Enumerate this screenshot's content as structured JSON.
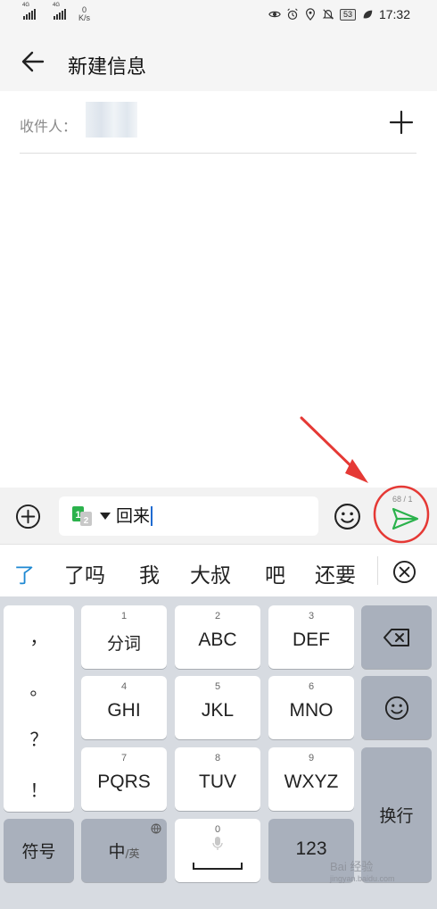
{
  "status_bar": {
    "network_1": "4G",
    "network_2": "4G",
    "speed_value": "0",
    "speed_unit": "K/s",
    "battery": "53",
    "time": "17:32",
    "icons": [
      "eye-icon",
      "alarm-icon",
      "location-icon",
      "mute-icon",
      "battery-icon",
      "leaf-icon"
    ]
  },
  "header": {
    "back_icon": "arrow-left-icon",
    "title": "新建信息"
  },
  "recipient": {
    "label": "收件人：",
    "add_icon": "plus-icon"
  },
  "compose": {
    "attach_icon": "circle-plus-icon",
    "sim_icon": "dual-sim-icon",
    "sim_1": "1",
    "sim_2": "2",
    "message": "回来",
    "emoji_icon": "smiley-icon",
    "char_count": "68 / 1",
    "send_icon": "send-icon"
  },
  "candidates": {
    "items": [
      "了",
      "了吗",
      "我",
      "大叔",
      "吧",
      "还要"
    ],
    "close_icon": "circle-x-icon"
  },
  "keyboard": {
    "punctuation": [
      "，",
      "。",
      "？",
      "！"
    ],
    "keys": [
      {
        "num": "1",
        "label": "分词"
      },
      {
        "num": "2",
        "label": "ABC"
      },
      {
        "num": "3",
        "label": "DEF"
      },
      {
        "num": "4",
        "label": "GHI"
      },
      {
        "num": "5",
        "label": "JKL"
      },
      {
        "num": "6",
        "label": "MNO"
      },
      {
        "num": "7",
        "label": "PQRS"
      },
      {
        "num": "8",
        "label": "TUV"
      },
      {
        "num": "9",
        "label": "WXYZ"
      }
    ],
    "zero_num": "0",
    "backspace_icon": "backspace-icon",
    "emoji_icon": "smiley-icon",
    "enter": "换行",
    "symbols": "符号",
    "lang_main": "中",
    "lang_sub": "/英",
    "globe_icon": "globe-icon",
    "mic_icon": "microphone-icon",
    "space_icon": "space-bar-icon",
    "numbers": "123"
  },
  "watermark": {
    "text": "Bai 经验",
    "sub": "jingyan.baidu.com"
  },
  "colors": {
    "accent_blue": "#1e88d2",
    "send_green": "#2bb24c",
    "annotation_red": "#e53935",
    "keyboard_bg": "#d7dbe1",
    "dark_key": "#a9b0bc"
  }
}
